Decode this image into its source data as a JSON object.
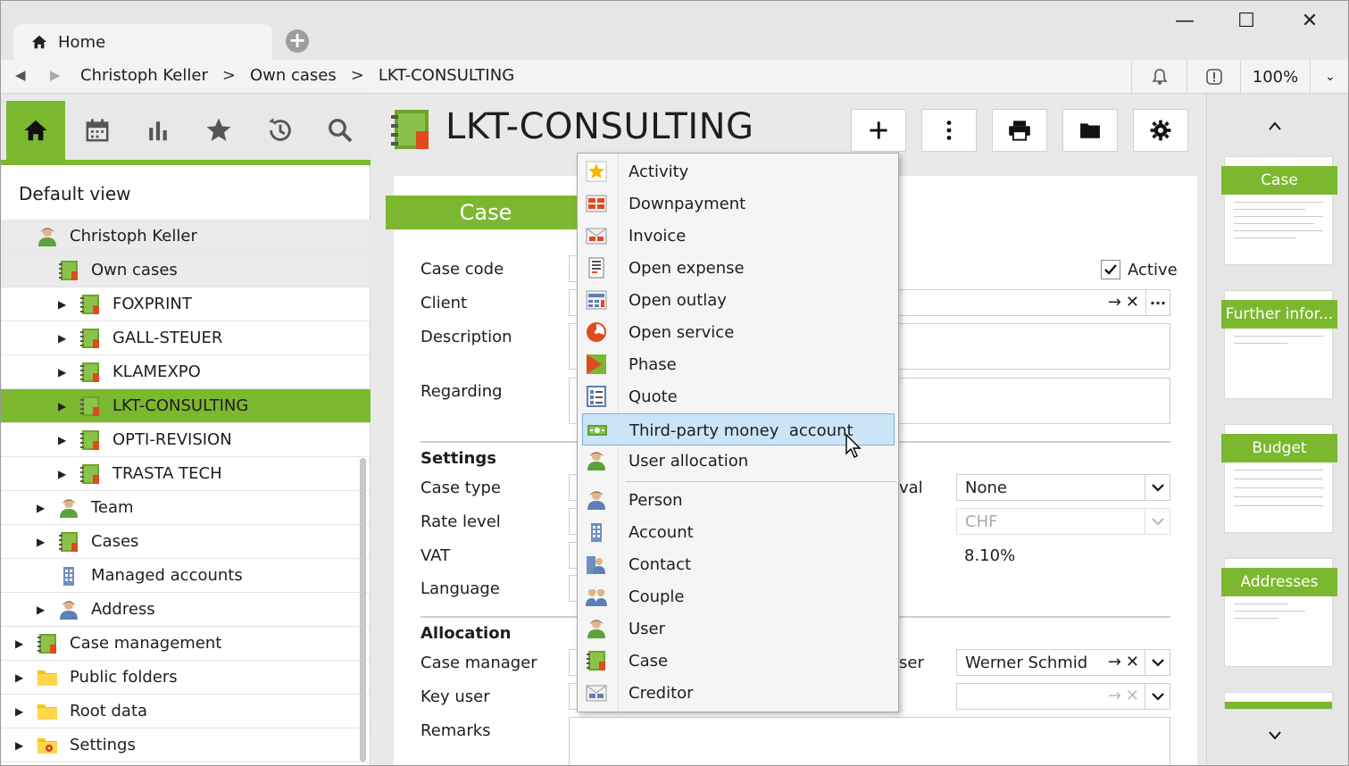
{
  "window": {
    "tab_label": "Home",
    "new_tab_icon": "plus-circle-icon",
    "minimize": "—",
    "maximize": "☐",
    "close": "✕"
  },
  "breadcrumb": {
    "items": [
      "Christoph Keller",
      "Own cases",
      "LKT-CONSULTING"
    ],
    "separator": ">",
    "zoom": "100%"
  },
  "left": {
    "view_title": "Default view",
    "tree": [
      {
        "label": "Christoph Keller",
        "icon": "user-icon"
      },
      {
        "label": "Own cases",
        "icon": "case-icon"
      },
      {
        "label": "FOXPRINT",
        "icon": "case-icon"
      },
      {
        "label": "GALL-STEUER",
        "icon": "case-icon"
      },
      {
        "label": "KLAMEXPO",
        "icon": "case-icon"
      },
      {
        "label": "LKT-CONSULTING",
        "icon": "case-icon"
      },
      {
        "label": "OPTI-REVISION",
        "icon": "case-icon"
      },
      {
        "label": "TRASTA TECH",
        "icon": "case-icon"
      },
      {
        "label": "Team",
        "icon": "user-icon"
      },
      {
        "label": "Cases",
        "icon": "case-icon"
      },
      {
        "label": "Managed accounts",
        "icon": "building-icon"
      },
      {
        "label": "Address",
        "icon": "person-icon"
      },
      {
        "label": "Case management",
        "icon": "case-icon"
      },
      {
        "label": "Public folders",
        "icon": "folder-icon"
      },
      {
        "label": "Root data",
        "icon": "folder-icon"
      },
      {
        "label": "Settings",
        "icon": "folder-settings-icon"
      }
    ]
  },
  "main": {
    "title": "LKT-CONSULTING",
    "section": "Case",
    "fields": {
      "case_code": "Case code",
      "client": "Client",
      "description": "Description",
      "regarding": "Regarding",
      "active": "Active",
      "settings": "Settings",
      "case_type": "Case type",
      "rate_level": "Rate level",
      "vat": "VAT",
      "language": "Language",
      "interval_suffix": "val",
      "interval_value": "None",
      "currency_value": "CHF",
      "vat_value": "8.10%",
      "allocation": "Allocation",
      "case_manager": "Case manager",
      "key_user": "Key user",
      "remarks": "Remarks",
      "user_suffix": "ser",
      "user_value": "Werner Schmid"
    }
  },
  "menu": {
    "items": [
      {
        "label": "Activity",
        "icon": "activity-star-icon"
      },
      {
        "label": "Downpayment",
        "icon": "downpayment-icon"
      },
      {
        "label": "Invoice",
        "icon": "invoice-envelope-icon"
      },
      {
        "label": "Open expense",
        "icon": "receipt-icon"
      },
      {
        "label": "Open outlay",
        "icon": "outlay-icon"
      },
      {
        "label": "Open service",
        "icon": "pie-clock-icon"
      },
      {
        "label": "Phase",
        "icon": "phase-flag-icon"
      },
      {
        "label": "Quote",
        "icon": "quote-list-icon"
      },
      {
        "label": "Third-party money  account",
        "icon": "money-icon"
      },
      {
        "label": "User allocation",
        "icon": "user-allocation-icon"
      },
      {
        "label": "Person",
        "icon": "person-icon"
      },
      {
        "label": "Account",
        "icon": "building-icon"
      },
      {
        "label": "Contact",
        "icon": "contact-icon"
      },
      {
        "label": "Couple",
        "icon": "couple-icon"
      },
      {
        "label": "User",
        "icon": "user-icon"
      },
      {
        "label": "Case",
        "icon": "case-icon"
      },
      {
        "label": "Creditor",
        "icon": "creditor-icon"
      }
    ]
  },
  "right": {
    "thumbs": [
      "Case",
      "Further infor...",
      "Budget",
      "Addresses"
    ]
  },
  "colors": {
    "accent": "#7cb82f",
    "highlight": "#cce4f7"
  }
}
